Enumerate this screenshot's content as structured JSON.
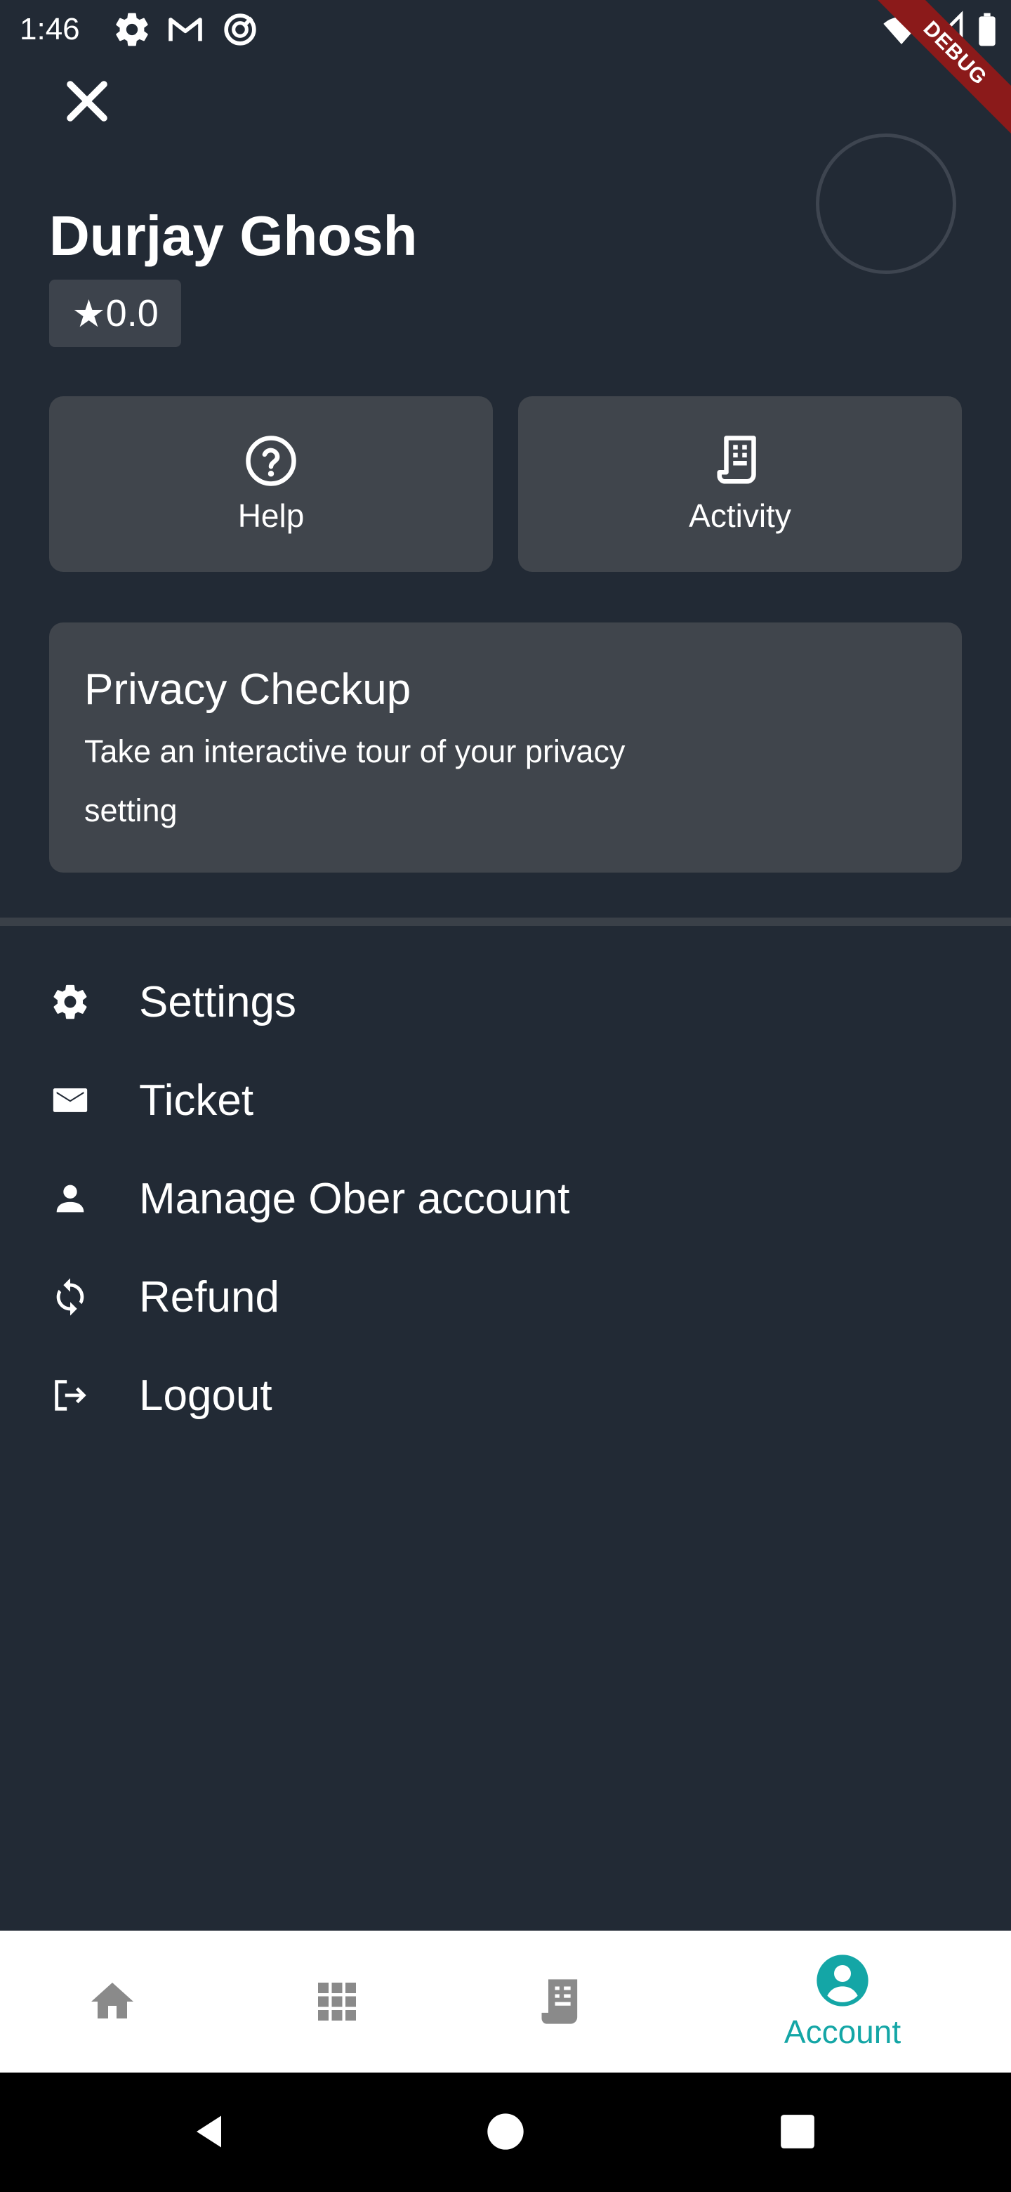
{
  "status_bar": {
    "time": "1:46",
    "icons": [
      "gear-icon",
      "gmail-icon",
      "data-saver-icon",
      "wifi-icon",
      "signal-icon",
      "battery-icon"
    ],
    "debug_banner": "DEBUG"
  },
  "profile": {
    "name": "Durjay Ghosh",
    "rating_star": "★",
    "rating": "0.0"
  },
  "tiles": {
    "help_label": "Help",
    "activity_label": "Activity"
  },
  "privacy_card": {
    "title": "Privacy Checkup",
    "description": "Take an interactive tour of your privacy setting"
  },
  "menu": {
    "items": [
      {
        "label": "Settings",
        "icon": "gear-icon"
      },
      {
        "label": "Ticket",
        "icon": "mail-icon"
      },
      {
        "label": "Manage Ober account",
        "icon": "person-icon"
      },
      {
        "label": "Refund",
        "icon": "sync-icon"
      },
      {
        "label": "Logout",
        "icon": "logout-icon"
      }
    ]
  },
  "bottom_nav": {
    "items": [
      {
        "icon": "home-icon",
        "label": ""
      },
      {
        "icon": "grid-icon",
        "label": ""
      },
      {
        "icon": "receipt-icon",
        "label": ""
      },
      {
        "icon": "account-icon",
        "label": "Account"
      }
    ],
    "active": "Account"
  },
  "colors": {
    "background": "#222a35",
    "card": "#40454c",
    "accent": "#14a6a6",
    "nav_inactive": "#8a8a8a",
    "debug_ribbon": "#8b1a1a"
  }
}
